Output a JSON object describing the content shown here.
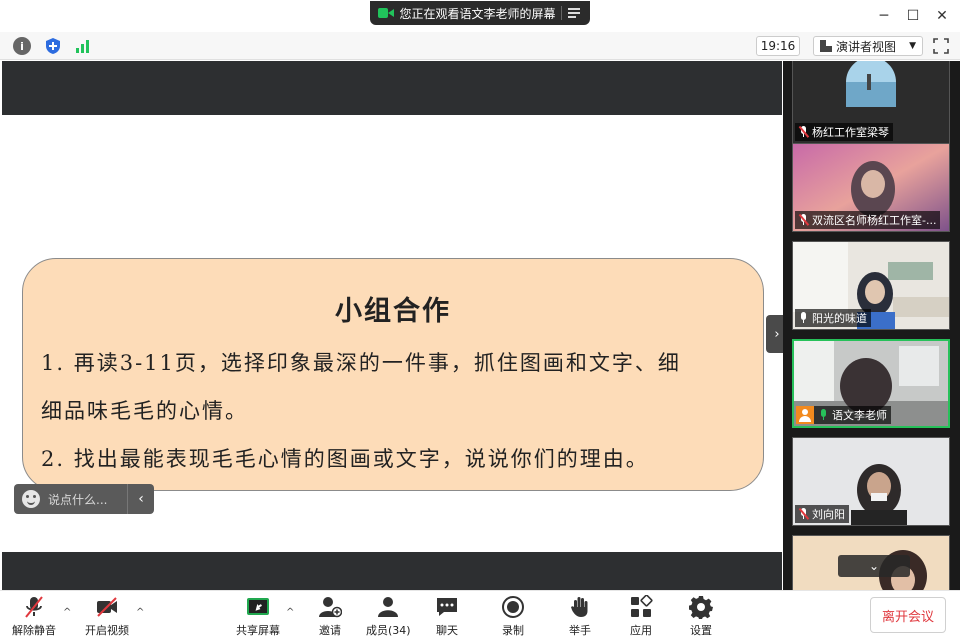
{
  "window": {
    "share_banner": "您正在观看语文李老师的屏幕",
    "minimize": "─",
    "maximize": "☐",
    "close": "✕"
  },
  "infobar": {
    "info_glyph": "i",
    "time": "19:16",
    "view_label": "演讲者视图",
    "view_caret": "▼"
  },
  "slide": {
    "title": "小组合作",
    "line1": "1. 再读3-11页，选择印象最深的一件事，抓住图画和文字、细",
    "line2": "细品味毛毛的心情。",
    "line3": "2. 找出最能表现毛毛心情的图画或文字，说说你们的理由。",
    "background_color": "#fddcb8"
  },
  "chat": {
    "placeholder": "说点什么...",
    "collapse_arrow": "‹"
  },
  "panel_handle": "›",
  "participants": [
    {
      "name": "杨红工作室梁琴",
      "muted": true
    },
    {
      "name": "双流区名师杨红工作室-...",
      "muted": true
    },
    {
      "name": "阳光的味道",
      "muted": false
    },
    {
      "name": "语文李老师",
      "muted": false,
      "active": true
    },
    {
      "name": "刘向阳",
      "muted": true
    },
    {
      "name": "",
      "muted": false
    }
  ],
  "gallery_scroll": "⌄",
  "toolbar": {
    "unmute": "解除静音",
    "start_video": "开启视频",
    "share_screen": "共享屏幕",
    "invite": "邀请",
    "members": "成员(34)",
    "chat": "聊天",
    "record": "录制",
    "raise_hand": "举手",
    "apps": "应用",
    "settings": "设置",
    "leave": "离开会议",
    "caret": "^"
  },
  "colors": {
    "accent_green": "#27c15a",
    "leave_red": "#e0383e",
    "banner_bg": "#2b2b2b"
  }
}
